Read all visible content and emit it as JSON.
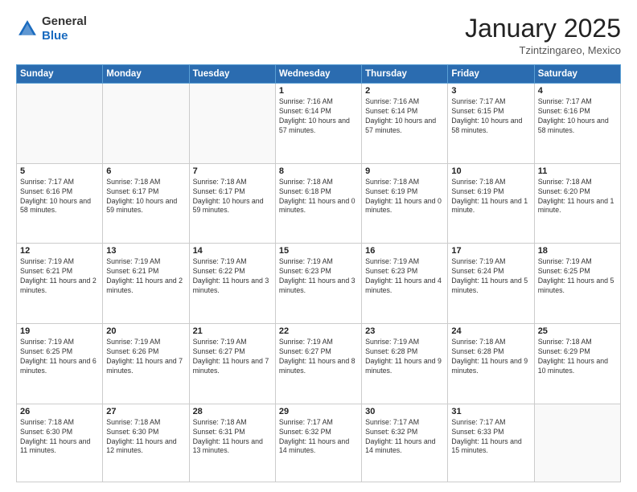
{
  "logo": {
    "general": "General",
    "blue": "Blue"
  },
  "header": {
    "month_title": "January 2025",
    "location": "Tzintzingareo, Mexico"
  },
  "weekdays": [
    "Sunday",
    "Monday",
    "Tuesday",
    "Wednesday",
    "Thursday",
    "Friday",
    "Saturday"
  ],
  "weeks": [
    [
      {
        "day": "",
        "info": ""
      },
      {
        "day": "",
        "info": ""
      },
      {
        "day": "",
        "info": ""
      },
      {
        "day": "1",
        "info": "Sunrise: 7:16 AM\nSunset: 6:14 PM\nDaylight: 10 hours and 57 minutes."
      },
      {
        "day": "2",
        "info": "Sunrise: 7:16 AM\nSunset: 6:14 PM\nDaylight: 10 hours and 57 minutes."
      },
      {
        "day": "3",
        "info": "Sunrise: 7:17 AM\nSunset: 6:15 PM\nDaylight: 10 hours and 58 minutes."
      },
      {
        "day": "4",
        "info": "Sunrise: 7:17 AM\nSunset: 6:16 PM\nDaylight: 10 hours and 58 minutes."
      }
    ],
    [
      {
        "day": "5",
        "info": "Sunrise: 7:17 AM\nSunset: 6:16 PM\nDaylight: 10 hours and 58 minutes."
      },
      {
        "day": "6",
        "info": "Sunrise: 7:18 AM\nSunset: 6:17 PM\nDaylight: 10 hours and 59 minutes."
      },
      {
        "day": "7",
        "info": "Sunrise: 7:18 AM\nSunset: 6:17 PM\nDaylight: 10 hours and 59 minutes."
      },
      {
        "day": "8",
        "info": "Sunrise: 7:18 AM\nSunset: 6:18 PM\nDaylight: 11 hours and 0 minutes."
      },
      {
        "day": "9",
        "info": "Sunrise: 7:18 AM\nSunset: 6:19 PM\nDaylight: 11 hours and 0 minutes."
      },
      {
        "day": "10",
        "info": "Sunrise: 7:18 AM\nSunset: 6:19 PM\nDaylight: 11 hours and 1 minute."
      },
      {
        "day": "11",
        "info": "Sunrise: 7:18 AM\nSunset: 6:20 PM\nDaylight: 11 hours and 1 minute."
      }
    ],
    [
      {
        "day": "12",
        "info": "Sunrise: 7:19 AM\nSunset: 6:21 PM\nDaylight: 11 hours and 2 minutes."
      },
      {
        "day": "13",
        "info": "Sunrise: 7:19 AM\nSunset: 6:21 PM\nDaylight: 11 hours and 2 minutes."
      },
      {
        "day": "14",
        "info": "Sunrise: 7:19 AM\nSunset: 6:22 PM\nDaylight: 11 hours and 3 minutes."
      },
      {
        "day": "15",
        "info": "Sunrise: 7:19 AM\nSunset: 6:23 PM\nDaylight: 11 hours and 3 minutes."
      },
      {
        "day": "16",
        "info": "Sunrise: 7:19 AM\nSunset: 6:23 PM\nDaylight: 11 hours and 4 minutes."
      },
      {
        "day": "17",
        "info": "Sunrise: 7:19 AM\nSunset: 6:24 PM\nDaylight: 11 hours and 5 minutes."
      },
      {
        "day": "18",
        "info": "Sunrise: 7:19 AM\nSunset: 6:25 PM\nDaylight: 11 hours and 5 minutes."
      }
    ],
    [
      {
        "day": "19",
        "info": "Sunrise: 7:19 AM\nSunset: 6:25 PM\nDaylight: 11 hours and 6 minutes."
      },
      {
        "day": "20",
        "info": "Sunrise: 7:19 AM\nSunset: 6:26 PM\nDaylight: 11 hours and 7 minutes."
      },
      {
        "day": "21",
        "info": "Sunrise: 7:19 AM\nSunset: 6:27 PM\nDaylight: 11 hours and 7 minutes."
      },
      {
        "day": "22",
        "info": "Sunrise: 7:19 AM\nSunset: 6:27 PM\nDaylight: 11 hours and 8 minutes."
      },
      {
        "day": "23",
        "info": "Sunrise: 7:19 AM\nSunset: 6:28 PM\nDaylight: 11 hours and 9 minutes."
      },
      {
        "day": "24",
        "info": "Sunrise: 7:18 AM\nSunset: 6:28 PM\nDaylight: 11 hours and 9 minutes."
      },
      {
        "day": "25",
        "info": "Sunrise: 7:18 AM\nSunset: 6:29 PM\nDaylight: 11 hours and 10 minutes."
      }
    ],
    [
      {
        "day": "26",
        "info": "Sunrise: 7:18 AM\nSunset: 6:30 PM\nDaylight: 11 hours and 11 minutes."
      },
      {
        "day": "27",
        "info": "Sunrise: 7:18 AM\nSunset: 6:30 PM\nDaylight: 11 hours and 12 minutes."
      },
      {
        "day": "28",
        "info": "Sunrise: 7:18 AM\nSunset: 6:31 PM\nDaylight: 11 hours and 13 minutes."
      },
      {
        "day": "29",
        "info": "Sunrise: 7:17 AM\nSunset: 6:32 PM\nDaylight: 11 hours and 14 minutes."
      },
      {
        "day": "30",
        "info": "Sunrise: 7:17 AM\nSunset: 6:32 PM\nDaylight: 11 hours and 14 minutes."
      },
      {
        "day": "31",
        "info": "Sunrise: 7:17 AM\nSunset: 6:33 PM\nDaylight: 11 hours and 15 minutes."
      },
      {
        "day": "",
        "info": ""
      }
    ]
  ]
}
